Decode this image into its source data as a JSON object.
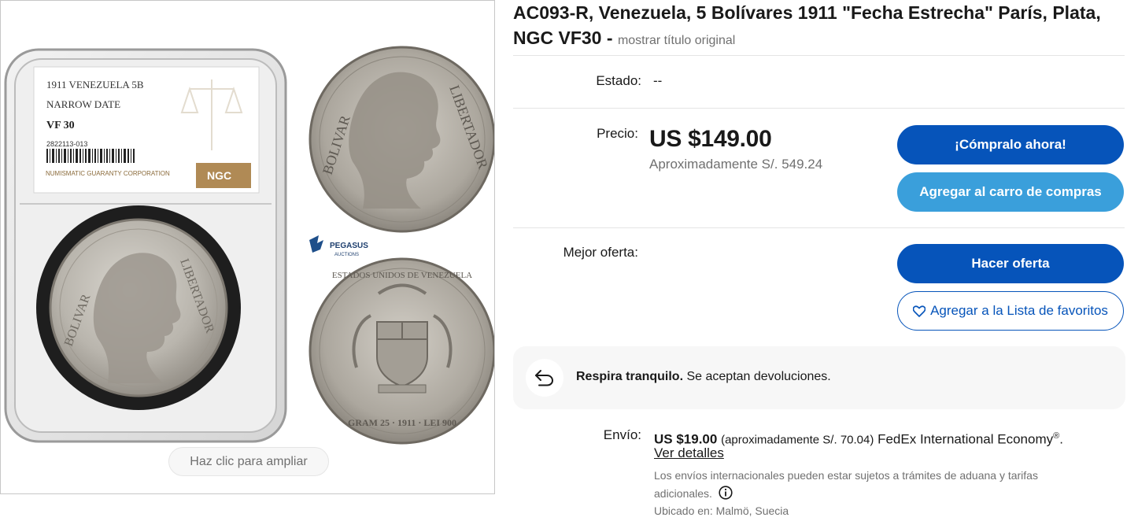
{
  "gallery": {
    "slab": {
      "line1": "1911 VENEZUELA 5B",
      "line2": "NARROW DATE",
      "grade": "VF 30",
      "cert": "2822113-013",
      "company": "NUMISMATIC GUARANTY CORPORATION",
      "logo": "NGC"
    },
    "obverse_legend_left": "BOLIVAR",
    "obverse_legend_right": "LIBERTADOR",
    "reverse_legend": "ESTADOS UNIDOS DE VENEZUELA",
    "reverse_bottom": "GRAM 25 · 1911 · LEI 900",
    "watermark_brand": "PEGASUS",
    "watermark_sub": "AUCTIONS",
    "zoom_hint": "Haz clic para ampliar"
  },
  "listing": {
    "title": "AC093-R, Venezuela, 5 Bolívares 1911 \"Fecha Estrecha\" París, Plata, NGC VF30",
    "title_sep": " - ",
    "show_original": "mostrar título original"
  },
  "condition": {
    "label": "Estado:",
    "value": "--"
  },
  "pricing": {
    "label": "Precio:",
    "price": "US $149.00",
    "approx": "Aproximadamente S/. 549.24"
  },
  "actions": {
    "buy_now": "¡Cómpralo ahora!",
    "add_to_cart": "Agregar al carro de compras",
    "best_offer_label": "Mejor oferta:",
    "make_offer": "Hacer oferta",
    "watchlist": "Agregar a la Lista de favoritos"
  },
  "returns": {
    "bold": "Respira tranquilo.",
    "text": " Se aceptan devoluciones."
  },
  "shipping": {
    "label": "Envío:",
    "amount": "US $19.00",
    "approx": "(aproximadamente S/. 70.04)",
    "service": "FedEx International Economy",
    "reg": "®",
    "period": ".",
    "details_link": "Ver detalles",
    "note": "Los envíos internacionales pueden estar sujetos a trámites de aduana y tarifas adicionales.",
    "location": "Ubicado en: Malmö, Suecia"
  },
  "colors": {
    "primary": "#0654ba",
    "secondary": "#3a9fdb",
    "muted": "#707070"
  },
  "icons": [
    "return-arrow-icon",
    "heart-icon",
    "info-icon"
  ]
}
